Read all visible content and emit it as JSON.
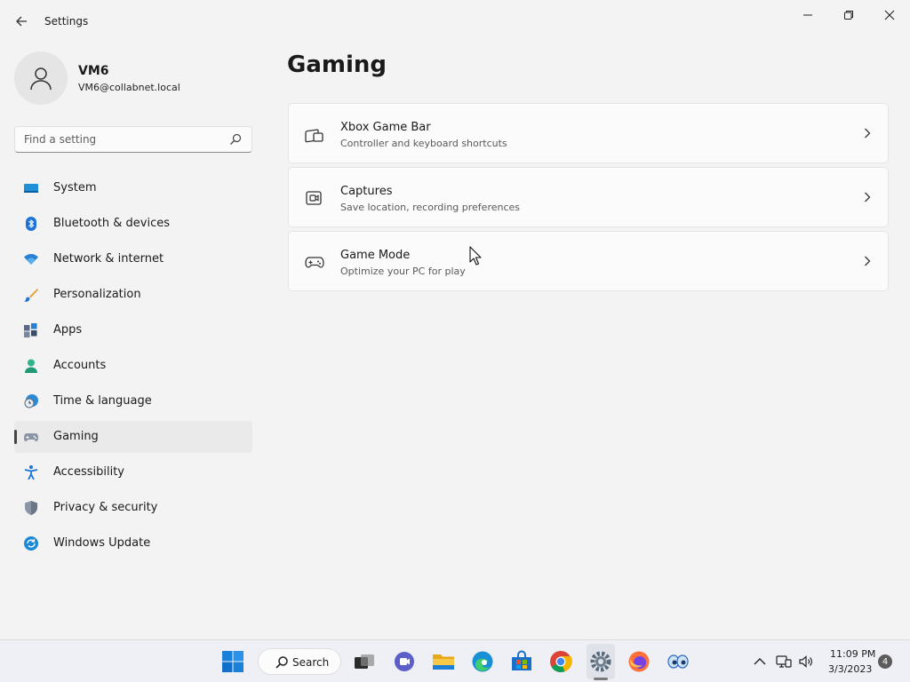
{
  "window": {
    "title": "Settings",
    "back_icon": "back-arrow-icon",
    "controls": [
      "minimize-icon",
      "maximize-icon",
      "close-icon"
    ]
  },
  "profile": {
    "name": "VM6",
    "email": "VM6@collabnet.local",
    "avatar_icon": "person-icon"
  },
  "search": {
    "placeholder": "Find a setting",
    "value": "",
    "icon": "search-icon"
  },
  "sidebar": {
    "items": [
      {
        "label": "System",
        "icon": "system-display-icon",
        "selected": false
      },
      {
        "label": "Bluetooth & devices",
        "icon": "bluetooth-icon",
        "selected": false
      },
      {
        "label": "Network & internet",
        "icon": "wifi-icon",
        "selected": false
      },
      {
        "label": "Personalization",
        "icon": "brush-icon",
        "selected": false
      },
      {
        "label": "Apps",
        "icon": "apps-icon",
        "selected": false
      },
      {
        "label": "Accounts",
        "icon": "account-icon",
        "selected": false
      },
      {
        "label": "Time & language",
        "icon": "clock-globe-icon",
        "selected": false
      },
      {
        "label": "Gaming",
        "icon": "gamepad-icon",
        "selected": true
      },
      {
        "label": "Accessibility",
        "icon": "accessibility-icon",
        "selected": false
      },
      {
        "label": "Privacy & security",
        "icon": "shield-icon",
        "selected": false
      },
      {
        "label": "Windows Update",
        "icon": "update-icon",
        "selected": false
      }
    ]
  },
  "main": {
    "title": "Gaming",
    "cards": [
      {
        "title": "Xbox Game Bar",
        "subtitle": "Controller and keyboard shortcuts",
        "icon": "game-bar-icon"
      },
      {
        "title": "Captures",
        "subtitle": "Save location, recording preferences",
        "icon": "capture-icon"
      },
      {
        "title": "Game Mode",
        "subtitle": "Optimize your PC for play",
        "icon": "gamepad-icon"
      }
    ]
  },
  "taskbar": {
    "search_label": "Search",
    "apps": [
      "windows-start-icon",
      "task-view-icon",
      "teams-chat-icon",
      "file-explorer-icon",
      "edge-icon",
      "store-icon",
      "chrome-icon",
      "settings-gear-icon",
      "firefox-icon",
      "eyes-app-icon"
    ],
    "active_app": "settings-gear-icon",
    "tray": [
      "chevron-up-icon",
      "network-monitor-icon",
      "volume-icon"
    ],
    "time": "11:09 PM",
    "date": "3/3/2023",
    "notification_count": "4"
  },
  "colors": {
    "background": "#f3f3f3",
    "card": "#fbfbfb",
    "selected_item": "#eaeaea",
    "accent_blue": "#0067c0"
  }
}
